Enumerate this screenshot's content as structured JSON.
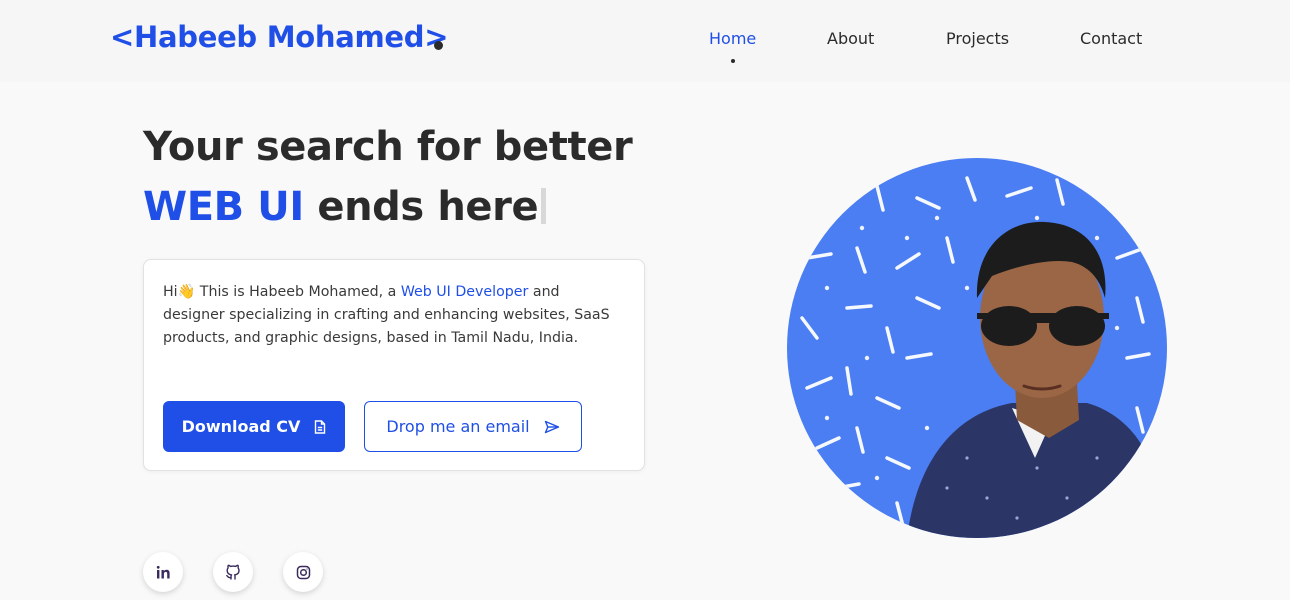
{
  "header": {
    "logo_prefix": "<",
    "logo_name": "Habeeb Mohamed",
    "logo_suffix": ">",
    "nav": [
      {
        "label": "Home",
        "active": true
      },
      {
        "label": "About",
        "active": false
      },
      {
        "label": "Projects",
        "active": false
      },
      {
        "label": "Contact",
        "active": false
      }
    ]
  },
  "hero": {
    "line1": "Your search for better",
    "line2_accent": "WEB UI",
    "line2_rest": " ends here",
    "intro": {
      "part1": "Hi👋 This is Habeeb Mohamed, a ",
      "link": "Web UI Developer",
      "part2": " and designer specializing in crafting and enhancing websites, SaaS products, and graphic designs, based in Tamil Nadu, India."
    },
    "download_cv_label": "Download CV",
    "email_label": "Drop me an email"
  },
  "social": [
    {
      "icon": "linkedin-icon"
    },
    {
      "icon": "github-icon"
    },
    {
      "icon": "instagram-icon"
    }
  ],
  "colors": {
    "accent": "#1f4fe6",
    "text": "#2b2b2b",
    "background": "#f9f9f9",
    "avatar_bg": "#4a7ef2"
  }
}
